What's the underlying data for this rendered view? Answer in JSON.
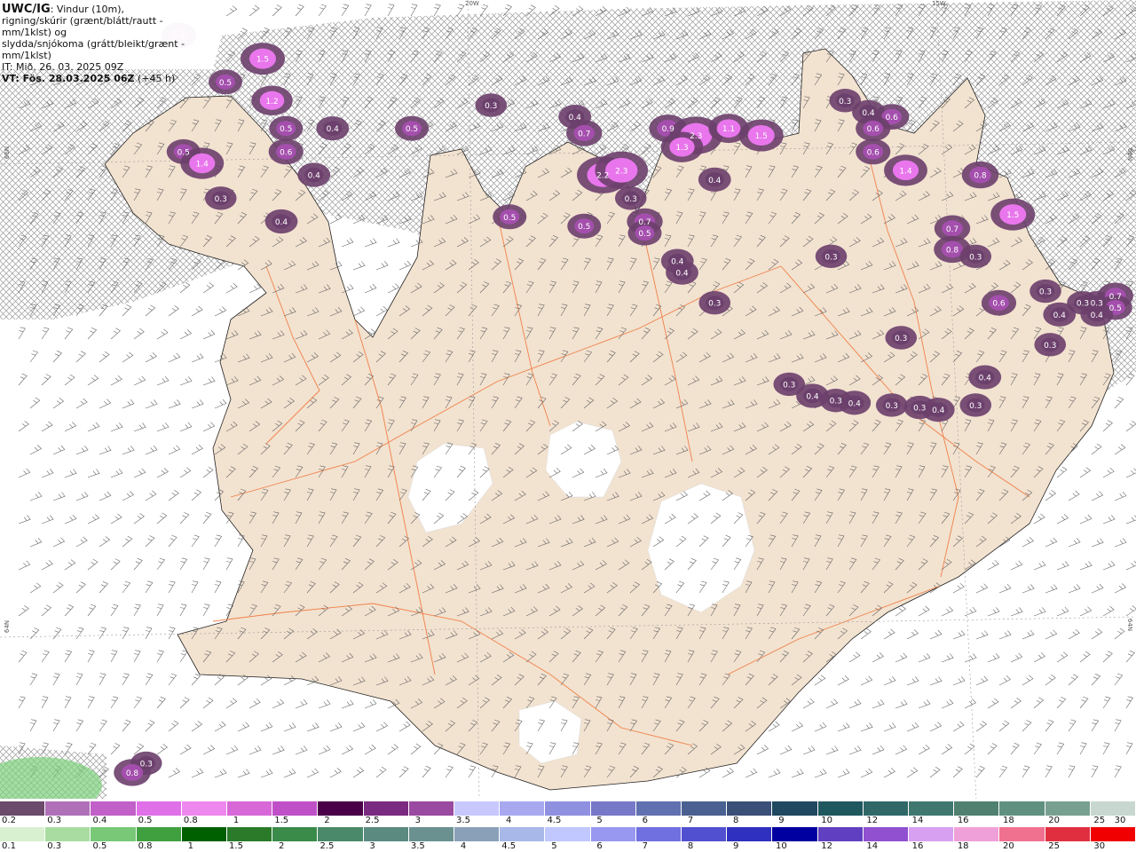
{
  "header": {
    "product": "UWC/IG",
    "line1_rest": ": Vindur (10m),",
    "line2": "rigning/skúrir (grænt/blátt/rautt - mm/1klst) og",
    "line3": "slydda/snjókoma (grátt/bleikt/grænt - mm/1klst)",
    "line4": "IT: Mið. 26. 03. 2025 09Z",
    "line5_bold": "VT: Fös. 28.03.2025 06Z",
    "line5_rest": " (+45 h)"
  },
  "grid_labels": {
    "lon_20w": "20W",
    "lon_15w": "15W",
    "lat_66n_left": "66N",
    "lat_64n_left": "64N",
    "lat_66n_right": "66N",
    "lat_64n_right": "64N"
  },
  "colors": {
    "land": "#f2e2d0",
    "sea": "#ffffff",
    "glacier": "#ffffff",
    "roads": "#f07030",
    "snow_dark": "#6b3f6b",
    "snow_mid": "#a64fb0",
    "snow_light": "#ef78f2",
    "rain_green": "#7cd07c",
    "hatch": "#9a9a9a"
  },
  "precip_labels": [
    {
      "v": "0.6",
      "lon": -23.1,
      "lat": 66.55
    },
    {
      "v": "1.5",
      "lon": -22.2,
      "lat": 66.45
    },
    {
      "v": "0.5",
      "lon": -22.6,
      "lat": 66.35
    },
    {
      "v": "1.2",
      "lon": -22.1,
      "lat": 66.27
    },
    {
      "v": "0.5",
      "lon": -21.95,
      "lat": 66.15
    },
    {
      "v": "0.4",
      "lon": -21.45,
      "lat": 66.15
    },
    {
      "v": "0.6",
      "lon": -21.95,
      "lat": 66.05
    },
    {
      "v": "0.5",
      "lon": -23.05,
      "lat": 66.05
    },
    {
      "v": "1.4",
      "lon": -22.85,
      "lat": 66.0
    },
    {
      "v": "0.4",
      "lon": -21.65,
      "lat": 65.95
    },
    {
      "v": "0.3",
      "lon": -22.65,
      "lat": 65.85
    },
    {
      "v": "0.4",
      "lon": -22.0,
      "lat": 65.75
    },
    {
      "v": "0.3",
      "lon": -19.75,
      "lat": 66.25
    },
    {
      "v": "0.5",
      "lon": -20.6,
      "lat": 66.15
    },
    {
      "v": "0.4",
      "lon": -18.85,
      "lat": 66.2
    },
    {
      "v": "0.7",
      "lon": -18.75,
      "lat": 66.13
    },
    {
      "v": "2.2",
      "lon": -18.55,
      "lat": 65.95
    },
    {
      "v": "2.3",
      "lon": -18.35,
      "lat": 65.97
    },
    {
      "v": "0.3",
      "lon": -18.25,
      "lat": 65.85
    },
    {
      "v": "0.5",
      "lon": -18.75,
      "lat": 65.73
    },
    {
      "v": "0.7",
      "lon": -18.1,
      "lat": 65.75
    },
    {
      "v": "0.5",
      "lon": -18.1,
      "lat": 65.7
    },
    {
      "v": "0.5",
      "lon": -19.55,
      "lat": 65.77
    },
    {
      "v": "0.9",
      "lon": -17.85,
      "lat": 66.15
    },
    {
      "v": "2.3",
      "lon": -17.55,
      "lat": 66.12
    },
    {
      "v": "1.1",
      "lon": -17.2,
      "lat": 66.15
    },
    {
      "v": "1.3",
      "lon": -17.7,
      "lat": 66.07
    },
    {
      "v": "1.5",
      "lon": -16.85,
      "lat": 66.12
    },
    {
      "v": "0.4",
      "lon": -17.35,
      "lat": 65.93
    },
    {
      "v": "0.4",
      "lon": -17.75,
      "lat": 65.58
    },
    {
      "v": "0.4",
      "lon": -17.7,
      "lat": 65.53
    },
    {
      "v": "0.3",
      "lon": -17.35,
      "lat": 65.4
    },
    {
      "v": "0.3",
      "lon": -15.95,
      "lat": 66.27
    },
    {
      "v": "0.4",
      "lon": -15.7,
      "lat": 66.22
    },
    {
      "v": "0.6",
      "lon": -15.45,
      "lat": 66.2
    },
    {
      "v": "0.6",
      "lon": -15.65,
      "lat": 66.15
    },
    {
      "v": "0.6",
      "lon": -15.65,
      "lat": 66.05
    },
    {
      "v": "1.4",
      "lon": -15.3,
      "lat": 65.97
    },
    {
      "v": "0.3",
      "lon": -16.1,
      "lat": 65.6
    },
    {
      "v": "0.8",
      "lon": -14.5,
      "lat": 65.95
    },
    {
      "v": "0.7",
      "lon": -14.8,
      "lat": 65.72
    },
    {
      "v": "0.8",
      "lon": -14.8,
      "lat": 65.63
    },
    {
      "v": "1.5",
      "lon": -14.15,
      "lat": 65.78
    },
    {
      "v": "0.3",
      "lon": -14.55,
      "lat": 65.6
    },
    {
      "v": "0.3",
      "lon": -13.8,
      "lat": 65.45
    },
    {
      "v": "0.6",
      "lon": -14.3,
      "lat": 65.4
    },
    {
      "v": "0.3",
      "lon": -13.4,
      "lat": 65.4
    },
    {
      "v": "0.3",
      "lon": -13.25,
      "lat": 65.4
    },
    {
      "v": "0.7",
      "lon": -13.05,
      "lat": 65.43
    },
    {
      "v": "0.5",
      "lon": -13.05,
      "lat": 65.38
    },
    {
      "v": "0.4",
      "lon": -13.65,
      "lat": 65.35
    },
    {
      "v": "0.4",
      "lon": -13.25,
      "lat": 65.35
    },
    {
      "v": "0.3",
      "lon": -13.75,
      "lat": 65.22
    },
    {
      "v": "0.3",
      "lon": -15.35,
      "lat": 65.25
    },
    {
      "v": "0.4",
      "lon": -14.45,
      "lat": 65.08
    },
    {
      "v": "0.3",
      "lon": -16.55,
      "lat": 65.05
    },
    {
      "v": "0.4",
      "lon": -16.3,
      "lat": 65.0
    },
    {
      "v": "0.3",
      "lon": -16.05,
      "lat": 64.98
    },
    {
      "v": "0.4",
      "lon": -15.85,
      "lat": 64.97
    },
    {
      "v": "0.3",
      "lon": -15.45,
      "lat": 64.96
    },
    {
      "v": "0.3",
      "lon": -15.15,
      "lat": 64.95
    },
    {
      "v": "0.4",
      "lon": -14.95,
      "lat": 64.94
    },
    {
      "v": "0.3",
      "lon": -14.55,
      "lat": 64.96
    },
    {
      "v": "0.3",
      "lon": -23.45,
      "lat": 63.42
    },
    {
      "v": "0.8",
      "lon": -23.6,
      "lat": 63.38
    }
  ],
  "legend": {
    "snow": {
      "labels": [
        "0.2",
        "0.3",
        "0.4",
        "0.5",
        "0.8",
        "1",
        "1.5",
        "2",
        "2.5",
        "3",
        "3.5",
        "4",
        "4.5",
        "5",
        "6",
        "7",
        "8",
        "9",
        "10",
        "12",
        "14",
        "16",
        "18",
        "20",
        "25",
        "30"
      ],
      "colors": [
        "#6b4a6b",
        "#b070b8",
        "#c060c8",
        "#e070e8",
        "#ee88ee",
        "#d868d8",
        "#c050c8",
        "#4a0048",
        "#7a2a80",
        "#9a4aa0",
        "#c8c8ff",
        "#a8a8f0",
        "#9090e0",
        "#7878c8",
        "#6070b0",
        "#4a6090",
        "#3a5078",
        "#204860",
        "#205860",
        "#306868",
        "#407870",
        "#508070",
        "#609080",
        "#78a090",
        "#c8d8d0"
      ]
    },
    "rain": {
      "labels": [
        "0.1",
        "0.3",
        "0.5",
        "0.8",
        "1",
        "1.5",
        "2",
        "2.5",
        "3",
        "3.5",
        "4",
        "4.5",
        "5",
        "6",
        "7",
        "8",
        "9",
        "10",
        "12",
        "14",
        "16",
        "18",
        "20",
        "25",
        "30"
      ],
      "colors": [
        "#d8f0d0",
        "#a8dca0",
        "#78c878",
        "#40a040",
        "#006000",
        "#2a7a2a",
        "#3a8a4a",
        "#4a8a6a",
        "#5a8a80",
        "#6a9090",
        "#8aa0b8",
        "#a8b8e8",
        "#c0c8ff",
        "#9898f0",
        "#7070e0",
        "#5050d0",
        "#3030c0",
        "#0000a0",
        "#6040c0",
        "#9050d0",
        "#d8a0f0",
        "#f0a0d8",
        "#f07090",
        "#e03040",
        "#f00000"
      ]
    }
  }
}
